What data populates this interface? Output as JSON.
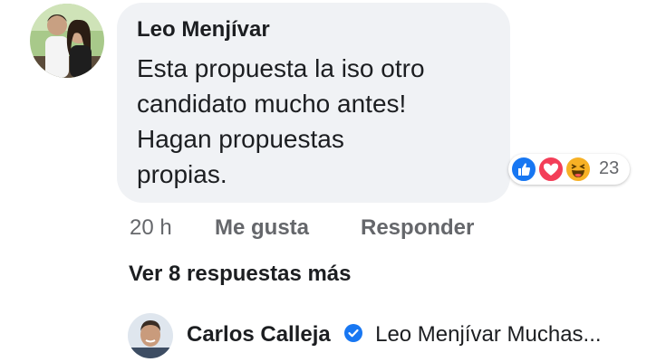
{
  "comment": {
    "author": "Leo Menjívar",
    "lines": [
      "Esta propuesta la iso otro",
      "candidato mucho antes!",
      "Hagan propuestas",
      "propias."
    ],
    "reactions": {
      "icons": [
        "like-icon",
        "love-icon",
        "haha-icon"
      ],
      "count": "23"
    },
    "time": "20 h",
    "like_label": "Me gusta",
    "reply_label": "Responder"
  },
  "more_replies_label": "Ver 8 respuestas más",
  "reply": {
    "author": "Carlos Calleja",
    "verified": true,
    "text": "Leo Menjívar Muchas..."
  },
  "colors": {
    "bubble": "#f0f2f5",
    "like": "#1877f2",
    "love": "#f33e58",
    "haha": "#f7b125",
    "secondary_text": "#65676b",
    "verified": "#1877f2"
  }
}
